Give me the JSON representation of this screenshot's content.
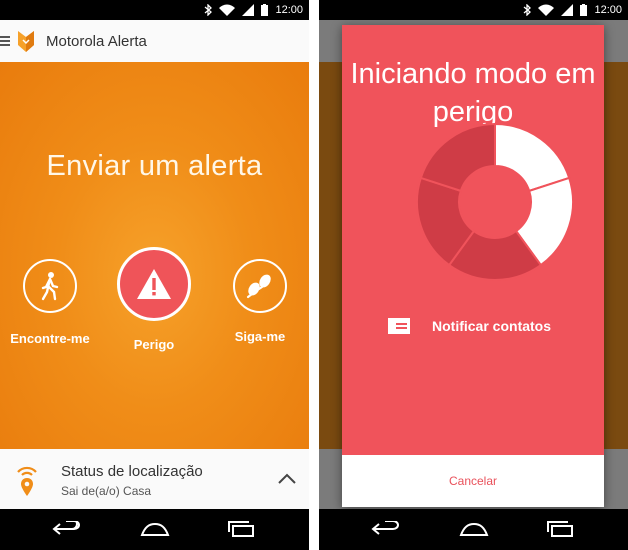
{
  "status_bar": {
    "time": "12:00"
  },
  "app": {
    "title": "Motorola Alerta"
  },
  "main": {
    "hero_title": "Enviar um alerta",
    "actions": [
      {
        "label": "Encontre-me",
        "icon": "walking-person-icon"
      },
      {
        "label": "Perigo",
        "icon": "warning-triangle-icon"
      },
      {
        "label": "Siga-me",
        "icon": "footprints-icon"
      }
    ]
  },
  "location_status": {
    "title": "Status de localização",
    "subtitle": "Sai de(a/o) Casa",
    "icon": "location-pin-wifi-icon"
  },
  "dialog": {
    "title": "Iniciando modo em perigo",
    "progress_fraction": 0.35,
    "notify_label": "Notificar contatos",
    "cancel_label": "Cancelar"
  },
  "colors": {
    "accent_orange": "#f08d18",
    "danger_red": "#f0535b",
    "donut_dark": "#cf3c46",
    "background_light": "#fafafa"
  }
}
